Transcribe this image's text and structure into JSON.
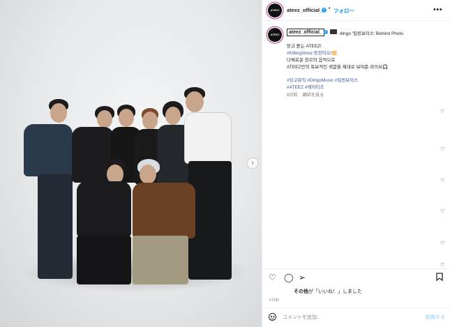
{
  "header": {
    "avatar_text": "ATEEZ",
    "username": "ateez_official_",
    "verified_glyph": "✓",
    "separator": "•",
    "follow_label": "フォロー",
    "more_label": "•••"
  },
  "caption": {
    "username": "ateez_official_",
    "headline": "dingo '킬링보이스' Behind Photo",
    "lines": [
      "믿고 듣는 ATEEZ!",
      "#KillingVoice 등장이오!💥",
      "다채로운 장르의 음악으로",
      "ATEEZ만의 독보적인 색깔을 제대로 보여준 라이브🎧"
    ],
    "hashtags_line1": "#딩고뮤직 #DingoMusic #킬링보이스",
    "hashtags_line2": "#ATEEZ #에이티즈",
    "time": "6日前",
    "translation_label": "翻訳を見る"
  },
  "likes": {
    "prefix": "その他",
    "middle": "が「いいね！」しました"
  },
  "date": "6日前",
  "comment": {
    "placeholder": "コメントを追加...",
    "post_label": "投稿する"
  },
  "icons": {
    "like": "heart-icon",
    "comment": "comment-icon",
    "share": "share-icon",
    "save": "bookmark-icon",
    "emoji": "emoji-icon",
    "next": "chevron-right-icon"
  },
  "colors": {
    "accent": "#0095f6",
    "hashtag": "#385898",
    "verified": "#2aa0f6"
  }
}
